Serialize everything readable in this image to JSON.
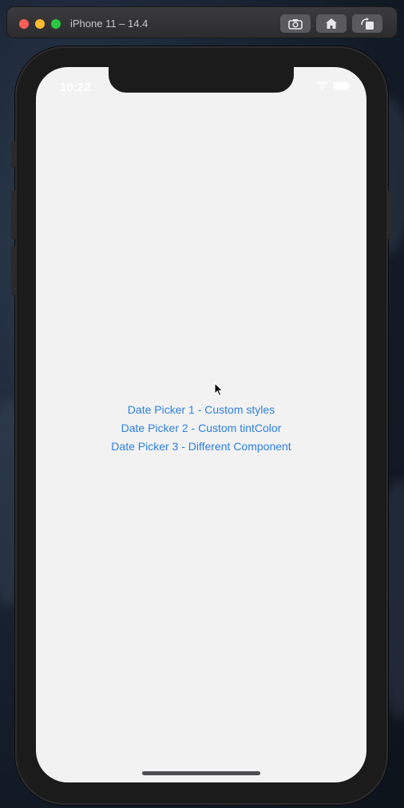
{
  "window": {
    "title": "iPhone 11 – 14.4",
    "buttons": [
      {
        "icon": "screenshot-icon"
      },
      {
        "icon": "home-icon"
      },
      {
        "icon": "rotate-icon"
      }
    ]
  },
  "status_bar": {
    "time": "10:22",
    "icons": [
      "wifi-icon",
      "battery-icon"
    ]
  },
  "main": {
    "links": [
      {
        "label": "Date Picker 1 - Custom styles"
      },
      {
        "label": "Date Picker 2 - Custom tintColor"
      },
      {
        "label": "Date Picker 3 - Different Component"
      }
    ]
  },
  "colors": {
    "link": "#2f7fe0",
    "screen_background": "#f2f2f2",
    "device_frame": "#1b1b1c"
  }
}
